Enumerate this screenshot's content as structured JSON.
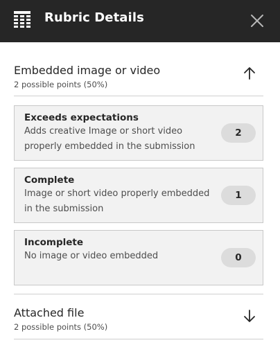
{
  "header": {
    "title": "Rubric Details",
    "close_icon": "close-icon",
    "rubric_icon": "rubric-grid-icon"
  },
  "sections": [
    {
      "title": "Embedded image or video",
      "subtitle": "2 possible points (50%)",
      "expanded": true,
      "toggle_icon": "arrow-up-icon",
      "criteria": [
        {
          "name": "Exceeds expectations",
          "description": "Adds creative Image or short video properly embedded in the submission",
          "points": "2"
        },
        {
          "name": "Complete",
          "description": "Image or short video properly embedded in the submission",
          "points": "1"
        },
        {
          "name": "Incomplete",
          "description": "No image or video embedded",
          "points": "0"
        }
      ]
    },
    {
      "title": "Attached file",
      "subtitle": "2 possible points (50%)",
      "expanded": false,
      "toggle_icon": "arrow-down-icon"
    }
  ],
  "colors": {
    "header_bg": "#262626",
    "card_bg": "#f2f2f2",
    "points_pill": "#dcdcdc"
  }
}
